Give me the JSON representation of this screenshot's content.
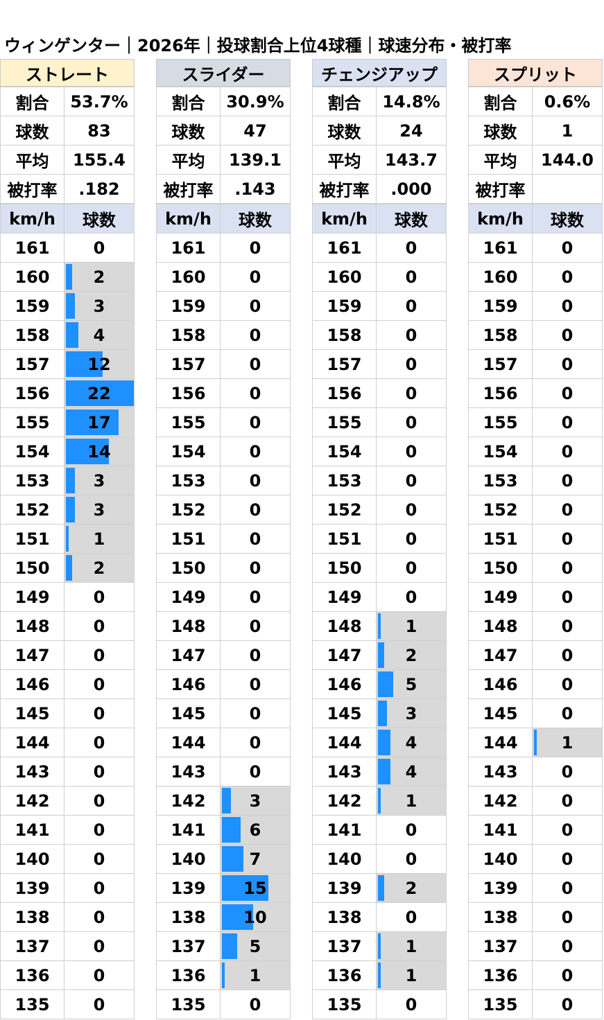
{
  "title": "ウィンゲンター｜2026年｜投球割合上位4球種｜球速分布・被打率",
  "chart_data": {
    "type": "table",
    "max_count": 22,
    "speeds": [
      161,
      160,
      159,
      158,
      157,
      156,
      155,
      154,
      153,
      152,
      151,
      150,
      149,
      148,
      147,
      146,
      145,
      144,
      143,
      142,
      141,
      140,
      139,
      138,
      137,
      136,
      135
    ],
    "column_labels": {
      "speed": "km/h",
      "count": "球数"
    },
    "stat_labels": {
      "ratio": "割合",
      "count": "球数",
      "avg": "平均",
      "baa": "被打率"
    },
    "pitches": [
      {
        "name": "ストレート",
        "header_color": "#fff2cc",
        "ratio": "53.7%",
        "count": "83",
        "avg": "155.4",
        "baa": ".182",
        "dist": [
          0,
          2,
          3,
          4,
          12,
          22,
          17,
          14,
          3,
          3,
          1,
          2,
          0,
          0,
          0,
          0,
          0,
          0,
          0,
          0,
          0,
          0,
          0,
          0,
          0,
          0,
          0
        ]
      },
      {
        "name": "スライダー",
        "header_color": "#d6dce4",
        "ratio": "30.9%",
        "count": "47",
        "avg": "139.1",
        "baa": ".143",
        "dist": [
          0,
          0,
          0,
          0,
          0,
          0,
          0,
          0,
          0,
          0,
          0,
          0,
          0,
          0,
          0,
          0,
          0,
          0,
          0,
          3,
          6,
          7,
          15,
          10,
          5,
          1,
          0
        ]
      },
      {
        "name": "チェンジアップ",
        "header_color": "#d9e1f2",
        "ratio": "14.8%",
        "count": "24",
        "avg": "143.7",
        "baa": ".000",
        "dist": [
          0,
          0,
          0,
          0,
          0,
          0,
          0,
          0,
          0,
          0,
          0,
          0,
          0,
          1,
          2,
          5,
          3,
          4,
          4,
          1,
          0,
          0,
          2,
          0,
          1,
          1,
          0
        ]
      },
      {
        "name": "スプリット",
        "header_color": "#fce4d6",
        "ratio": "0.6%",
        "count": "1",
        "avg": "144.0",
        "baa": "",
        "dist": [
          0,
          0,
          0,
          0,
          0,
          0,
          0,
          0,
          0,
          0,
          0,
          0,
          0,
          0,
          0,
          0,
          0,
          1,
          0,
          0,
          0,
          0,
          0,
          0,
          0,
          0,
          0
        ]
      }
    ]
  }
}
